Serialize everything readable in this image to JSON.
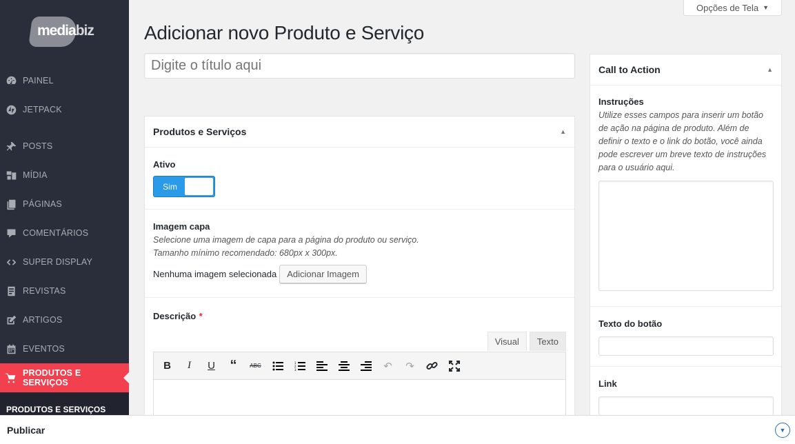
{
  "brand": {
    "logo_text_a": "media",
    "logo_text_b": "biz"
  },
  "sidebar": {
    "items": [
      {
        "label": "PAINEL",
        "icon": "dashboard-icon"
      },
      {
        "label": "JETPACK",
        "icon": "jetpack-icon"
      },
      {
        "label": "POSTS",
        "icon": "pin-icon"
      },
      {
        "label": "MÍDIA",
        "icon": "media-icon"
      },
      {
        "label": "PÁGINAS",
        "icon": "pages-icon"
      },
      {
        "label": "COMENTÁRIOS",
        "icon": "comment-icon"
      },
      {
        "label": "SUPER DISPLAY",
        "icon": "code-icon"
      },
      {
        "label": "REVISTAS",
        "icon": "magazine-icon"
      },
      {
        "label": "ARTIGOS",
        "icon": "edit-icon"
      },
      {
        "label": "EVENTOS",
        "icon": "calendar-icon"
      },
      {
        "label": "PRODUTOS E SERVIÇOS",
        "icon": "cart-icon",
        "active": true
      }
    ],
    "submenu_label": "PRODUTOS E SERVIÇOS"
  },
  "header": {
    "screen_options": "Opções de Tela",
    "page_title": "Adicionar novo Produto e Serviço",
    "title_placeholder": "Digite o título aqui"
  },
  "main_box": {
    "title": "Produtos e Serviços",
    "active_label": "Ativo",
    "toggle_label": "Sim",
    "cover_label": "Imagem capa",
    "cover_desc_1": "Selecione uma imagem de capa para a página do produto ou serviço.",
    "cover_desc_2": "Tamanho mínimo recomendado: 680px x 300px.",
    "no_image": "Nenhuma imagem selecionada",
    "add_image_button": "Adicionar Imagem",
    "description_label": "Descrição",
    "required_mark": "*",
    "tab_visual": "Visual",
    "tab_text": "Texto"
  },
  "side_box": {
    "title": "Call to Action",
    "instructions_label": "Instruções",
    "instructions_desc": "Utilize esses campos para inserir um botão de ação na página de produto. Além de definir o texto e o link do botão, você ainda pode escrever um breve texto de instruções para o usuário aqui.",
    "button_text_label": "Texto do botão",
    "link_label": "Link"
  },
  "footer": {
    "publish_label": "Publicar"
  },
  "colors": {
    "sidebar_bg": "#2a2e3b",
    "active_accent": "#f2404f",
    "toggle_blue": "#2b9ae8"
  }
}
